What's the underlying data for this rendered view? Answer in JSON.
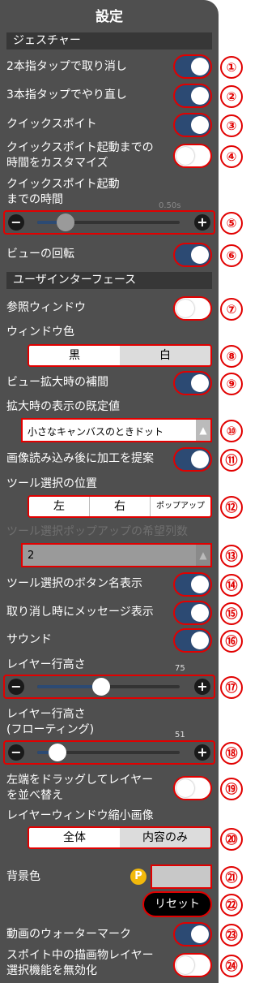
{
  "title": "設定",
  "sections": {
    "gesture": "ジェスチャー",
    "interface": "ユーザインターフェース"
  },
  "rows": {
    "two_finger_undo": {
      "label": "2本指タップで取り消し",
      "on": true
    },
    "three_finger_redo": {
      "label": "3本指タップでやり直し",
      "on": true
    },
    "quick_eyedropper": {
      "label": "クイックスポイト",
      "on": true
    },
    "customize_time": {
      "label_line1": "クイックスポイト起動までの",
      "label_line2": "時間をカスタマイズ",
      "on": false
    },
    "quick_eyedropper_time": {
      "label_line1": "クイックスポイト起動",
      "label_line2": "までの時間",
      "value": "0.50s"
    },
    "view_rotation": {
      "label": "ビューの回転",
      "on": true
    },
    "reference_window": {
      "label": "参照ウィンドウ",
      "on": false
    },
    "window_color": {
      "label": "ウィンドウ色",
      "options": [
        "黒",
        "白"
      ],
      "selected": "黒"
    },
    "view_zoom_interp": {
      "label": "ビュー拡大時の補間",
      "on": true
    },
    "zoom_default": {
      "label": "拡大時の表示の既定値",
      "value": "小さなキャンバスのときドット"
    },
    "suggest_processing": {
      "label": "画像読み込み後に加工を提案",
      "on": true
    },
    "tool_position": {
      "label": "ツール選択の位置",
      "options": [
        "左",
        "右",
        "ポップアップ"
      ],
      "selected": "左"
    },
    "tool_popup_columns": {
      "label": "ツール選択ポップアップの希望列数",
      "value": "2"
    },
    "tool_button_names": {
      "label": "ツール選択のボタン名表示",
      "on": true
    },
    "undo_message": {
      "label": "取り消し時にメッセージ表示",
      "on": true
    },
    "sound": {
      "label": "サウンド",
      "on": true
    },
    "layer_height": {
      "label": "レイヤー行高さ",
      "value": "75"
    },
    "layer_height_floating": {
      "label_line1": "レイヤー行高さ",
      "label_line2": "(フローティング)",
      "value": "51"
    },
    "drag_reorder": {
      "label_line1": "左端をドラッグしてレイヤー",
      "label_line2": "を並べ替え",
      "on": false
    },
    "layer_thumbnail": {
      "label": "レイヤーウィンドウ縮小画像",
      "options": [
        "全体",
        "内容のみ"
      ],
      "selected": "全体"
    },
    "background_color": {
      "label": "背景色",
      "premium_badge": "P",
      "color": "#c8c8c8"
    },
    "reset": {
      "label": "リセット"
    },
    "video_watermark": {
      "label": "動画のウォーターマーク",
      "on": true
    },
    "eyedropper_disable_layer": {
      "label_line1": "スポイト中の描画物レイヤー",
      "label_line2": "選択機能を無効化",
      "on": false
    }
  },
  "sliders": {
    "quick_time": {
      "fraction": 0.2,
      "minus": "−",
      "plus": "+"
    },
    "layer_height": {
      "fraction": 0.45,
      "minus": "−",
      "plus": "+"
    },
    "layer_height_floating": {
      "fraction": 0.14,
      "minus": "−",
      "plus": "+"
    }
  },
  "badges": [
    "①",
    "②",
    "③",
    "④",
    "⑤",
    "⑥",
    "⑦",
    "⑧",
    "⑨",
    "⑩",
    "⑪",
    "⑫",
    "⑬",
    "⑭",
    "⑮",
    "⑯",
    "⑰",
    "⑱",
    "⑲",
    "⑳",
    "㉑",
    "㉒",
    "㉓",
    "㉔"
  ],
  "colors": {
    "panel": "#4f4f4f",
    "section": "#373737",
    "toggle_on": "#2c4a73",
    "highlight": "#e10000",
    "premium": "#f2b90c"
  }
}
